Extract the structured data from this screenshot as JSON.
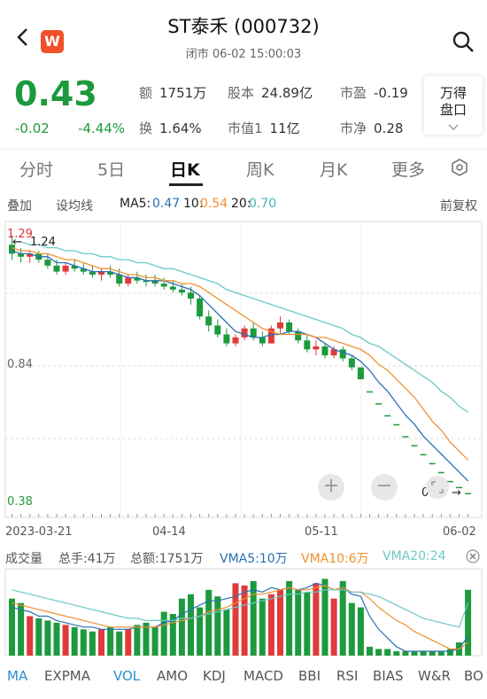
{
  "header": {
    "title": "ST泰禾 (000732)",
    "status": "闭市 06-02 15:00:03",
    "logo": "W",
    "back_icon": "chevron-left",
    "search_icon": "search"
  },
  "quote": {
    "price": "0.43",
    "change": "-0.02",
    "change_pct": "-4.44%",
    "fields": [
      {
        "k": "额",
        "v": "1751万"
      },
      {
        "k": "股本",
        "v": "24.89亿"
      },
      {
        "k": "市盈",
        "v": "-0.19"
      },
      {
        "k": "换",
        "v": "1.64%"
      },
      {
        "k": "市值1",
        "v": "11亿"
      },
      {
        "k": "市净",
        "v": "0.28"
      }
    ],
    "wande_line1": "万得",
    "wande_line2": "盘口"
  },
  "tabs": [
    "分时",
    "5日",
    "日K",
    "周K",
    "月K",
    "更多"
  ],
  "active_tab": "日K",
  "ma_bar": {
    "overlay": "叠加",
    "set_ma": "设均线",
    "ma5_label": "MA5:",
    "ma5": "0.47",
    "ma10_label": "10:",
    "ma10": "0.54",
    "ma20_label": "20:",
    "ma20": "0.70",
    "adjust": "前复权"
  },
  "price_axis": {
    "top": "1.29",
    "mid": "0.84",
    "bottom": "0.38",
    "high_marker": "1.24",
    "low_marker": "0.43"
  },
  "date_axis": [
    "2023-03-21",
    "04-14",
    "05-11",
    "06-02"
  ],
  "volume_bar": {
    "label": "成交量",
    "total_hands": "总手:41万",
    "total_amount": "总额:1751万",
    "vma5": "VMA5:10万",
    "vma10": "VMA10:6万",
    "vma20": "VMA20:24"
  },
  "indicators": [
    "MA",
    "EXPMA",
    "VOL",
    "AMO",
    "KDJ",
    "MACD",
    "BBI",
    "RSI",
    "BIAS",
    "W&R",
    "BO"
  ],
  "colors": {
    "up": "#e03a3a",
    "down": "#1c9a3d",
    "ma5": "#2b6fb3",
    "ma10": "#f09030",
    "ma20": "#6cc8c8"
  },
  "chart_data": {
    "type": "candlestick",
    "ohlc": [
      [
        1.26,
        1.29,
        1.21,
        1.23
      ],
      [
        1.23,
        1.25,
        1.2,
        1.22
      ],
      [
        1.22,
        1.24,
        1.2,
        1.23
      ],
      [
        1.23,
        1.24,
        1.2,
        1.21
      ],
      [
        1.21,
        1.23,
        1.18,
        1.19
      ],
      [
        1.19,
        1.21,
        1.16,
        1.17
      ],
      [
        1.17,
        1.2,
        1.16,
        1.19
      ],
      [
        1.19,
        1.21,
        1.17,
        1.18
      ],
      [
        1.18,
        1.2,
        1.16,
        1.17
      ],
      [
        1.17,
        1.19,
        1.15,
        1.16
      ],
      [
        1.16,
        1.18,
        1.14,
        1.17
      ],
      [
        1.17,
        1.19,
        1.15,
        1.16
      ],
      [
        1.16,
        1.18,
        1.12,
        1.13
      ],
      [
        1.13,
        1.16,
        1.12,
        1.15
      ],
      [
        1.15,
        1.17,
        1.13,
        1.14
      ],
      [
        1.14,
        1.16,
        1.12,
        1.14
      ],
      [
        1.14,
        1.16,
        1.12,
        1.13
      ],
      [
        1.13,
        1.15,
        1.11,
        1.12
      ],
      [
        1.12,
        1.14,
        1.1,
        1.11
      ],
      [
        1.11,
        1.13,
        1.09,
        1.1
      ],
      [
        1.1,
        1.12,
        1.06,
        1.08
      ],
      [
        1.08,
        1.09,
        1.01,
        1.02
      ],
      [
        1.02,
        1.04,
        0.97,
        0.99
      ],
      [
        0.99,
        1.01,
        0.95,
        0.96
      ],
      [
        0.96,
        0.98,
        0.92,
        0.93
      ],
      [
        0.93,
        0.96,
        0.92,
        0.95
      ],
      [
        0.95,
        0.99,
        0.94,
        0.98
      ],
      [
        0.98,
        1.0,
        0.94,
        0.95
      ],
      [
        0.95,
        0.97,
        0.92,
        0.93
      ],
      [
        0.93,
        0.99,
        0.93,
        0.98
      ],
      [
        0.98,
        1.02,
        0.96,
        1.0
      ],
      [
        1.0,
        1.01,
        0.96,
        0.97
      ],
      [
        0.97,
        0.98,
        0.93,
        0.94
      ],
      [
        0.94,
        0.96,
        0.9,
        0.91
      ],
      [
        0.91,
        0.94,
        0.89,
        0.92
      ],
      [
        0.92,
        0.93,
        0.88,
        0.89
      ],
      [
        0.89,
        0.92,
        0.88,
        0.91
      ],
      [
        0.91,
        0.92,
        0.87,
        0.88
      ],
      [
        0.88,
        0.89,
        0.84,
        0.85
      ],
      [
        0.85,
        0.85,
        0.81,
        0.81
      ],
      [
        0.77,
        0.77,
        0.77,
        0.77
      ],
      [
        0.73,
        0.73,
        0.73,
        0.73
      ],
      [
        0.69,
        0.69,
        0.69,
        0.69
      ],
      [
        0.66,
        0.66,
        0.66,
        0.66
      ],
      [
        0.62,
        0.62,
        0.62,
        0.62
      ],
      [
        0.59,
        0.59,
        0.59,
        0.59
      ],
      [
        0.56,
        0.56,
        0.56,
        0.56
      ],
      [
        0.53,
        0.53,
        0.53,
        0.53
      ],
      [
        0.5,
        0.5,
        0.5,
        0.5
      ],
      [
        0.47,
        0.47,
        0.47,
        0.47
      ],
      [
        0.45,
        0.45,
        0.45,
        0.45
      ],
      [
        0.43,
        0.43,
        0.43,
        0.43
      ]
    ],
    "ma5": [
      1.24,
      1.23,
      1.23,
      1.22,
      1.22,
      1.2,
      1.2,
      1.19,
      1.18,
      1.17,
      1.17,
      1.17,
      1.16,
      1.15,
      1.15,
      1.14,
      1.14,
      1.14,
      1.13,
      1.12,
      1.11,
      1.09,
      1.06,
      1.03,
      1.0,
      0.97,
      0.96,
      0.95,
      0.95,
      0.96,
      0.96,
      0.97,
      0.97,
      0.96,
      0.95,
      0.93,
      0.91,
      0.9,
      0.89,
      0.87,
      0.84,
      0.8,
      0.77,
      0.73,
      0.69,
      0.66,
      0.62,
      0.59,
      0.56,
      0.53,
      0.5,
      0.47
    ],
    "ma10": [
      1.25,
      1.24,
      1.24,
      1.23,
      1.23,
      1.22,
      1.21,
      1.21,
      1.2,
      1.19,
      1.18,
      1.18,
      1.17,
      1.16,
      1.16,
      1.15,
      1.15,
      1.14,
      1.14,
      1.13,
      1.13,
      1.12,
      1.1,
      1.08,
      1.06,
      1.04,
      1.02,
      1.0,
      0.98,
      0.97,
      0.96,
      0.96,
      0.96,
      0.96,
      0.95,
      0.95,
      0.94,
      0.93,
      0.92,
      0.91,
      0.89,
      0.86,
      0.84,
      0.81,
      0.78,
      0.75,
      0.71,
      0.67,
      0.64,
      0.6,
      0.57,
      0.54
    ],
    "ma20": [
      1.27,
      1.27,
      1.26,
      1.26,
      1.25,
      1.25,
      1.24,
      1.24,
      1.23,
      1.23,
      1.22,
      1.22,
      1.21,
      1.21,
      1.2,
      1.2,
      1.19,
      1.18,
      1.18,
      1.17,
      1.16,
      1.15,
      1.14,
      1.13,
      1.11,
      1.1,
      1.09,
      1.08,
      1.07,
      1.06,
      1.05,
      1.04,
      1.03,
      1.02,
      1.01,
      1.0,
      0.99,
      0.98,
      0.96,
      0.95,
      0.93,
      0.92,
      0.9,
      0.88,
      0.86,
      0.84,
      0.82,
      0.8,
      0.77,
      0.75,
      0.72,
      0.7
    ],
    "volume": [
      26,
      24,
      18,
      17,
      16,
      15,
      14,
      13,
      12,
      11,
      12,
      13,
      11,
      12,
      14,
      15,
      13,
      20,
      19,
      26,
      28,
      22,
      30,
      27,
      21,
      33,
      32,
      34,
      26,
      28,
      30,
      34,
      30,
      29,
      33,
      35,
      26,
      34,
      24,
      22,
      4,
      3,
      3,
      2,
      2,
      2,
      2,
      2,
      2,
      3,
      6,
      30
    ],
    "vma5": [
      22,
      21,
      20,
      18,
      18,
      16,
      15,
      14,
      13,
      13,
      12,
      12,
      12,
      12,
      13,
      13,
      13,
      15,
      16,
      19,
      21,
      23,
      25,
      25,
      26,
      27,
      29,
      30,
      29,
      31,
      30,
      31,
      30,
      31,
      33,
      32,
      30,
      31,
      28,
      27,
      18,
      12,
      8,
      4,
      2,
      2,
      2,
      2,
      2,
      2,
      3,
      9
    ],
    "vma10": [
      24,
      23,
      22,
      21,
      20,
      19,
      18,
      17,
      16,
      15,
      14,
      13,
      13,
      13,
      13,
      13,
      13,
      14,
      15,
      16,
      17,
      18,
      20,
      21,
      22,
      24,
      26,
      28,
      28,
      29,
      30,
      31,
      30,
      30,
      31,
      32,
      30,
      31,
      29,
      29,
      26,
      22,
      19,
      16,
      14,
      11,
      9,
      7,
      5,
      3,
      3,
      6
    ],
    "vma20": [
      30,
      29,
      28,
      27,
      26,
      25,
      24,
      23,
      22,
      21,
      20,
      19,
      18,
      17,
      17,
      16,
      16,
      16,
      16,
      17,
      17,
      18,
      19,
      20,
      21,
      22,
      23,
      24,
      25,
      26,
      27,
      28,
      28,
      29,
      29,
      30,
      30,
      30,
      29,
      29,
      28,
      27,
      25,
      23,
      21,
      19,
      17,
      16,
      15,
      14,
      13,
      24
    ]
  }
}
